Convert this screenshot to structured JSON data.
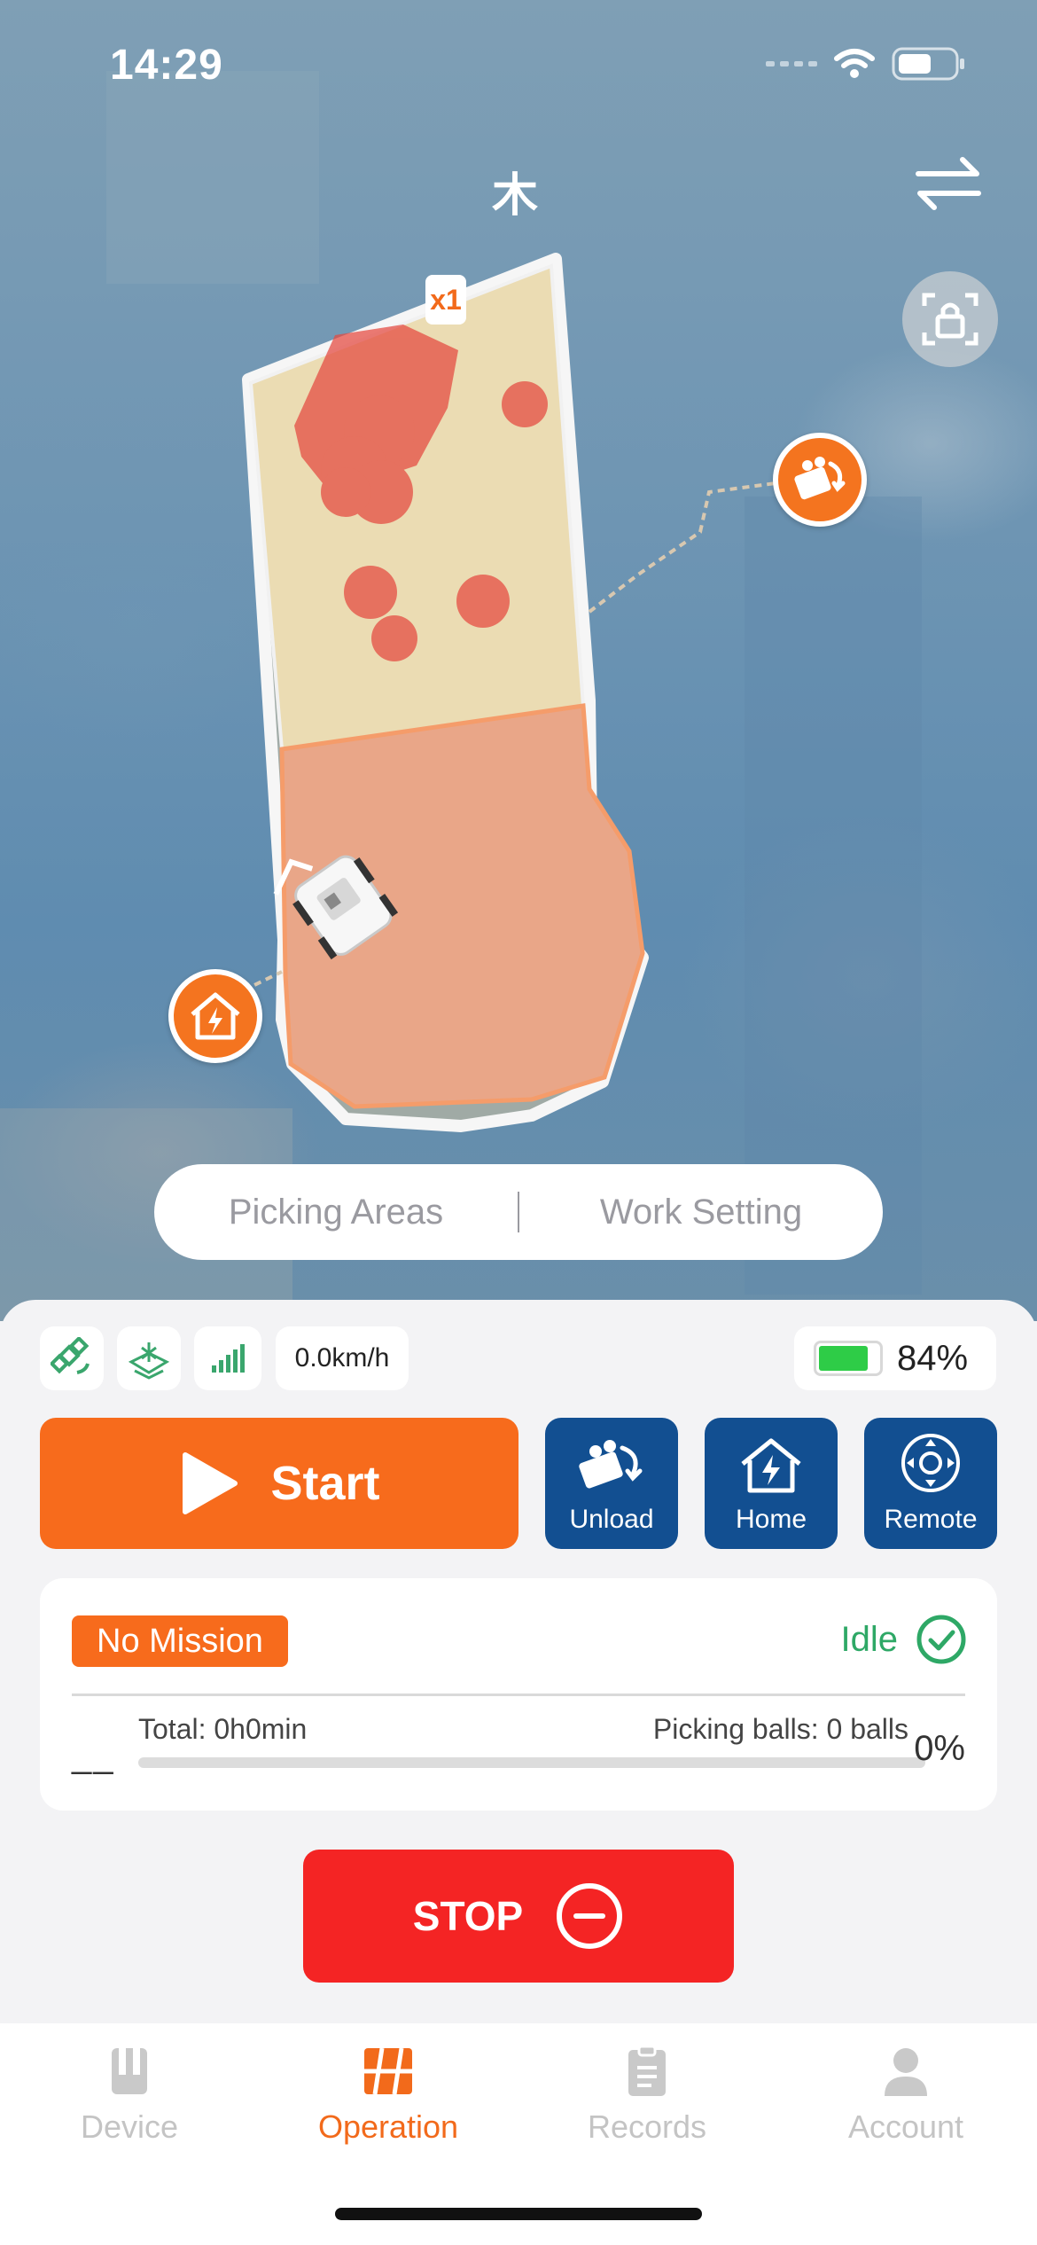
{
  "status_bar": {
    "time": "14:29"
  },
  "header": {
    "title_glyph": "木"
  },
  "map": {
    "repeat_badge": "x1"
  },
  "segmented": {
    "picking_areas": "Picking Areas",
    "work_setting": "Work Setting"
  },
  "indicators": {
    "speed": "0.0km/h",
    "battery_percent": "84%",
    "battery_level": 0.84
  },
  "actions": {
    "start": "Start",
    "unload": "Unload",
    "home": "Home",
    "remote": "Remote"
  },
  "mission": {
    "badge": "No Mission",
    "state": "Idle",
    "dash": "__",
    "total": "Total: 0h0min",
    "picking_balls": "Picking balls: 0 balls",
    "percent": "0%",
    "progress": 0
  },
  "stop": {
    "label": "STOP"
  },
  "tabs": [
    {
      "label": "Device"
    },
    {
      "label": "Operation"
    },
    {
      "label": "Records"
    },
    {
      "label": "Account"
    }
  ],
  "colors": {
    "accent": "#f76b1c",
    "primary_blue": "#124f91",
    "stop_red": "#f42424",
    "idle_green": "#2ea866"
  }
}
